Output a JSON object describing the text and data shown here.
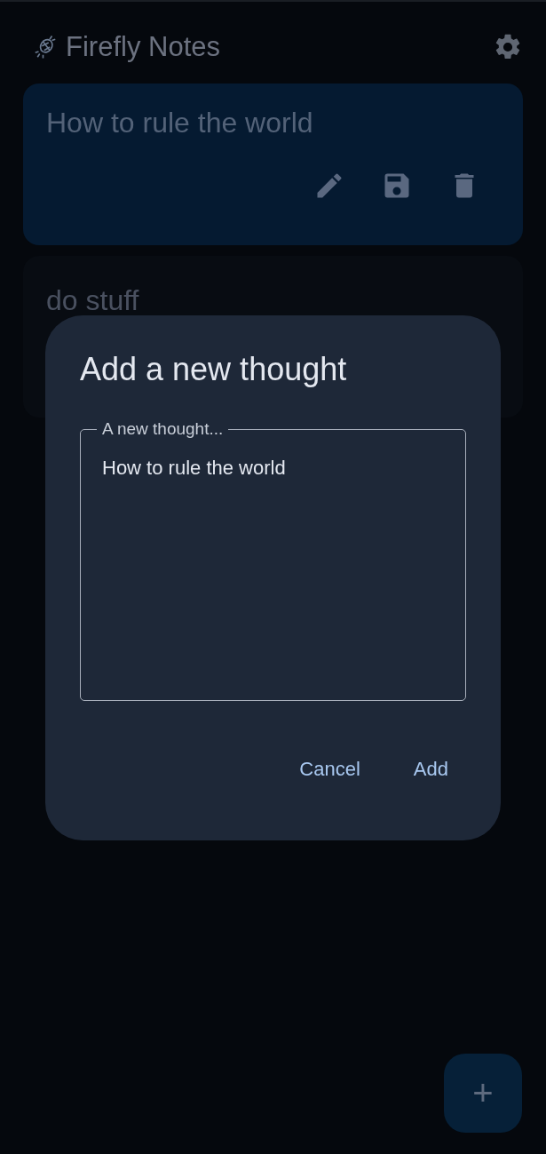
{
  "app_bar": {
    "title": "Firefly Notes"
  },
  "notes": [
    {
      "text": "How to rule the world",
      "selected": true
    },
    {
      "text": "do stuff",
      "selected": false
    }
  ],
  "dialog": {
    "title": "Add a new thought",
    "field": {
      "label": "A new thought...",
      "value": "How to rule the world"
    },
    "buttons": [
      "Cancel",
      "Add"
    ]
  },
  "fab": {
    "label": "+"
  }
}
